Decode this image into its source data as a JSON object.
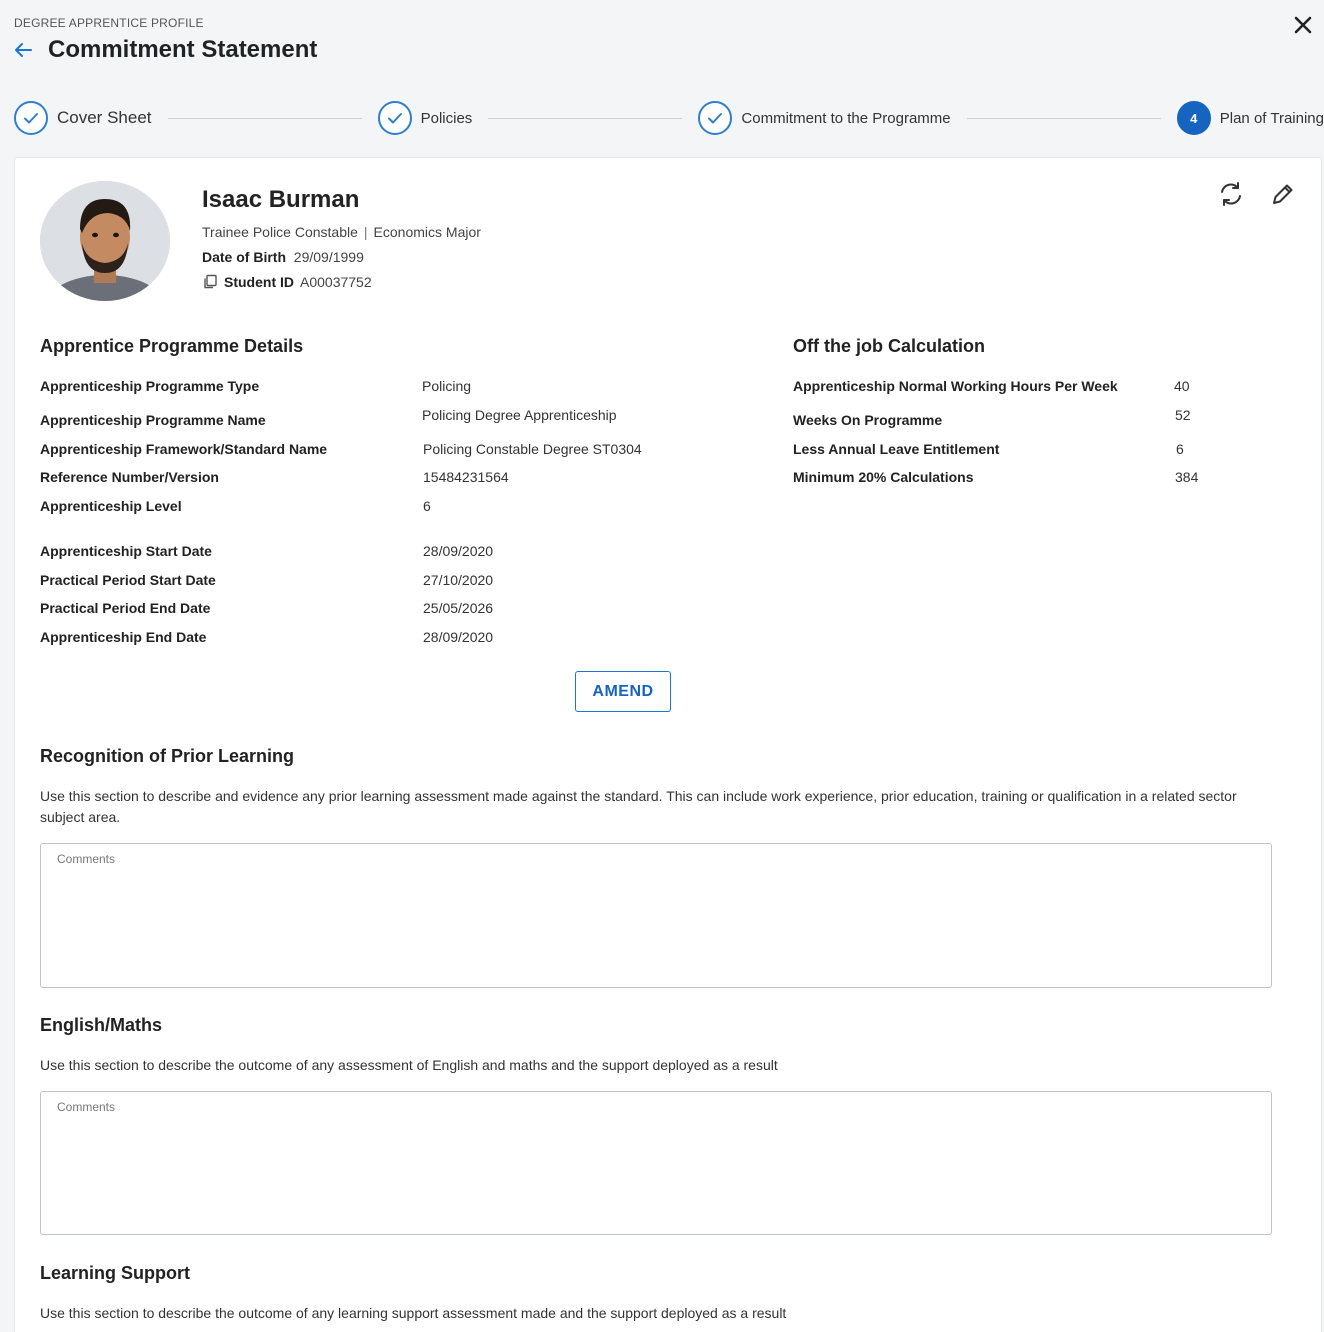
{
  "header": {
    "eyebrow": "DEGREE APPRENTICE PROFILE",
    "title": "Commitment Statement"
  },
  "stepper": [
    {
      "label": "Cover Sheet",
      "state": "done"
    },
    {
      "label": "Policies",
      "state": "done"
    },
    {
      "label": "Commitment to the Programme",
      "state": "done"
    },
    {
      "label": "Plan of Training",
      "state": "active",
      "number": "4"
    }
  ],
  "profile": {
    "name": "Isaac Burman",
    "role": "Trainee Police Constable",
    "role_sep": "|",
    "major": "Economics Major",
    "dob_label": "Date of Birth",
    "dob": "29/09/1999",
    "student_id_label": "Student ID",
    "student_id": "A00037752"
  },
  "programme": {
    "title": "Apprentice Programme Details",
    "rows": [
      {
        "label": "Apprenticeship Programme Type",
        "value": "Policing"
      },
      {
        "label": "Apprenticeship Programme Name",
        "value": "Policing Degree Apprenticeship"
      },
      {
        "label": "Apprenticeship Framework/Standard Name",
        "value": "Policing Constable Degree ST0304"
      },
      {
        "label": "Reference Number/Version",
        "value": "15484231564"
      },
      {
        "label": "Apprenticeship Level",
        "value": "6"
      },
      {
        "label": "Apprenticeship Start Date",
        "value": "28/09/2020"
      },
      {
        "label": "Practical Period Start Date",
        "value": "27/10/2020"
      },
      {
        "label": "Practical Period End Date",
        "value": "25/05/2026"
      },
      {
        "label": "Apprenticeship End Date",
        "value": "28/09/2020"
      }
    ]
  },
  "offjob": {
    "title": "Off the job Calculation",
    "rows": [
      {
        "label": "Apprenticeship Normal Working Hours Per Week",
        "value": "40"
      },
      {
        "label": "Weeks On Programme",
        "value": "52"
      },
      {
        "label": "Less Annual Leave Entitlement",
        "value": "6"
      },
      {
        "label": "Minimum 20% Calculations",
        "value": "384"
      }
    ]
  },
  "amend_label": "AMEND",
  "sections": {
    "prior": {
      "title": "Recognition of Prior Learning",
      "desc": "Use this section to describe and evidence any prior learning assessment made against the standard. This can include work experience, prior education, training or qualification in a related sector subject area.",
      "placeholder": "Comments"
    },
    "english": {
      "title": "English/Maths",
      "desc": "Use this section to describe the outcome of any assessment of English and maths and the support deployed as a result",
      "placeholder": "Comments"
    },
    "support": {
      "title": "Learning Support",
      "desc": "Use this section to describe the outcome of any learning support assessment made and the support deployed as a result"
    }
  },
  "colors": {
    "accent": "#1565c0",
    "step_ring": "#2f7fd0"
  }
}
